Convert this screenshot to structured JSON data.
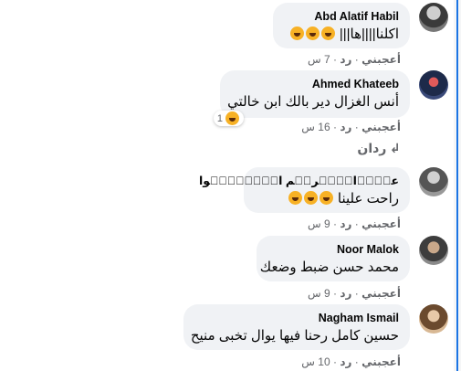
{
  "comments": [
    {
      "author": "Abd Alatif Habil",
      "text": "اكلنا||||ها|||",
      "emojis": [
        "laughing-emoji",
        "crying-emoji",
        "laughing-emoji"
      ],
      "like": "أعجبني",
      "reply": "رد",
      "time": "7 س"
    },
    {
      "author": "Ahmed Khateeb",
      "text": "أنس الغزال دير بالك ابن خالتي",
      "like": "أعجبني",
      "reply": "رد",
      "time": "16 س",
      "reaction_count": "1",
      "replies_label": "ردان"
    },
    {
      "author": "عبۨدۨالۨكۨريۨم الۨجۨحۨلۨوا",
      "text": "راحت علينا",
      "like": "أعجبني",
      "reply": "رد",
      "time": "9 س"
    },
    {
      "author": "Noor Malok",
      "text": "محمد حسن ضبط وضعك",
      "like": "أعجبني",
      "reply": "رد",
      "time": "9 س"
    },
    {
      "author": "Nagham Ismail",
      "text": "حسين كامل رحنا فيها يوال تخبى منيح",
      "like": "أعجبني",
      "reply": "رد",
      "time": "10 س"
    }
  ],
  "colors": {
    "bubble": "#f0f2f5",
    "meta_text": "#65676b",
    "accent": "#1b74e4",
    "emoji_yellow": "#f7b125"
  },
  "separator": "·"
}
